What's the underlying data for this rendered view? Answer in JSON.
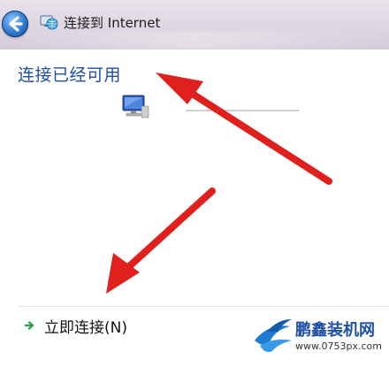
{
  "window": {
    "title": "连接到 Internet"
  },
  "page": {
    "heading": "连接已经可用",
    "connect_action": "立即连接(N)"
  },
  "watermark": {
    "brand": "鹏鑫装机网",
    "url": "www.0753px.com"
  },
  "icons": {
    "back": "back-arrow-icon",
    "network": "network-globe-icon",
    "computer": "computer-connection-icon",
    "go": "green-arrow-icon"
  },
  "colors": {
    "heading": "#1f4fa6",
    "annotation_arrow": "#e0201c",
    "go_arrow": "#2ea043"
  }
}
